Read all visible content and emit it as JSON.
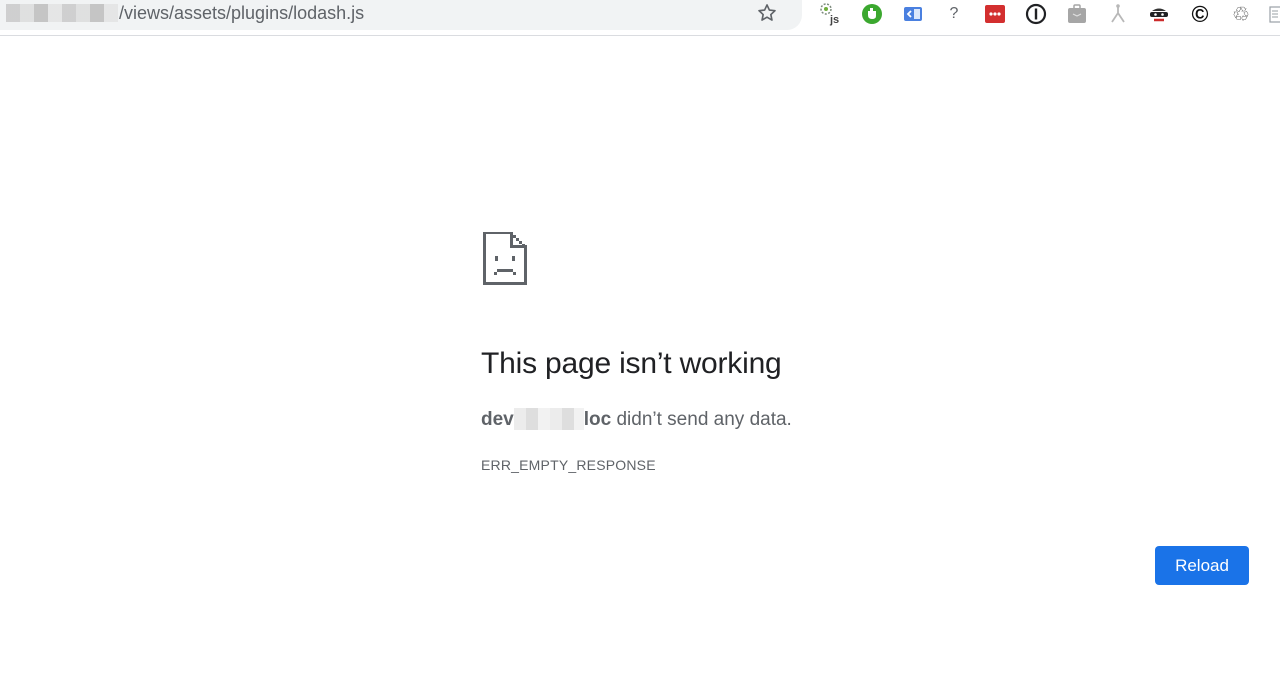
{
  "address_bar": {
    "url_path": "/views/assets/plugins/lodash.js"
  },
  "extensions": [
    {
      "icon": "js-extension-icon"
    },
    {
      "icon": "green-shield-icon"
    },
    {
      "icon": "blue-panel-icon"
    },
    {
      "icon": "help-icon",
      "label": "?"
    },
    {
      "icon": "red-dots-icon"
    },
    {
      "icon": "1password-icon"
    },
    {
      "icon": "briefcase-icon"
    },
    {
      "icon": "branch-icon"
    },
    {
      "icon": "incognito-icon"
    },
    {
      "icon": "copyright-icon",
      "label": "©"
    },
    {
      "icon": "recycle-icon",
      "label": "♲"
    }
  ],
  "error_page": {
    "title": "This page isn’t working",
    "host_prefix": "dev",
    "host_suffix": "loc",
    "message": " didn’t send any data.",
    "error_code": "ERR_EMPTY_RESPONSE",
    "reload_label": "Reload"
  },
  "colors": {
    "accent": "#1a73e8",
    "text_primary": "#202124",
    "text_secondary": "#5f6368"
  }
}
